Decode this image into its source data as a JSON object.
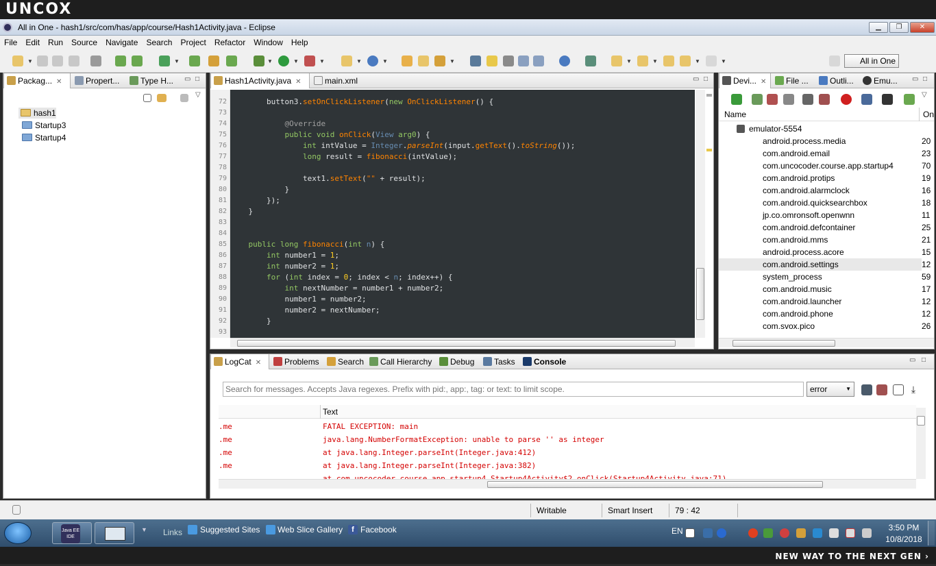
{
  "brand": {
    "top": "UNCOX",
    "bottom": "NEW WAY TO THE NEXT GEN ›"
  },
  "window": {
    "title": "All in One - hash1/src/com/has/app/course/Hash1Activity.java - Eclipse"
  },
  "menu": [
    "File",
    "Edit",
    "Run",
    "Source",
    "Navigate",
    "Search",
    "Project",
    "Refactor",
    "Window",
    "Help"
  ],
  "perspective": "All in One",
  "left_panel": {
    "tabs": [
      "Packag...",
      "Propert...",
      "Type H..."
    ],
    "tree": [
      "hash1",
      "Startup3",
      "Startup4"
    ]
  },
  "editor": {
    "tabs": [
      "Hash1Activity.java",
      "main.xml"
    ],
    "line_numbers": [
      "72",
      "73",
      "74",
      "75",
      "76",
      "77",
      "78",
      "79",
      "80",
      "81",
      "82",
      "83",
      "84",
      "85",
      "86",
      "87",
      "88",
      "89",
      "90",
      "91",
      "92",
      "93"
    ]
  },
  "devices_panel": {
    "tabs": [
      "Devi...",
      "File ...",
      "Outli...",
      "Emu..."
    ],
    "col_name": "Name",
    "col_other": "On",
    "emulator": "emulator-5554",
    "processes": [
      {
        "name": "android.process.media",
        "val": "20"
      },
      {
        "name": "com.android.email",
        "val": "23"
      },
      {
        "name": "com.uncocoder.course.app.startup4",
        "val": "70"
      },
      {
        "name": "com.android.protips",
        "val": "19"
      },
      {
        "name": "com.android.alarmclock",
        "val": "16"
      },
      {
        "name": "com.android.quicksearchbox",
        "val": "18"
      },
      {
        "name": "jp.co.omronsoft.openwnn",
        "val": "11"
      },
      {
        "name": "com.android.defcontainer",
        "val": "25"
      },
      {
        "name": "com.android.mms",
        "val": "21"
      },
      {
        "name": "android.process.acore",
        "val": "15"
      },
      {
        "name": "com.android.settings",
        "val": "12"
      },
      {
        "name": "system_process",
        "val": "59"
      },
      {
        "name": "com.android.music",
        "val": "17"
      },
      {
        "name": "com.android.launcher",
        "val": "12"
      },
      {
        "name": "com.android.phone",
        "val": "12"
      },
      {
        "name": "com.svox.pico",
        "val": "26"
      }
    ]
  },
  "console": {
    "tabs": [
      "LogCat",
      "Problems",
      "Search",
      "Call Hierarchy",
      "Debug",
      "Tasks",
      "Console"
    ],
    "search_placeholder": "Search for messages. Accepts Java regexes. Prefix with pid:, app:, tag: or text: to limit scope.",
    "level": "error",
    "col_text": "Text",
    "rows": [
      {
        "app": ".me",
        "text": "FATAL EXCEPTION: main"
      },
      {
        "app": ".me",
        "text": "java.lang.NumberFormatException: unable to parse '' as integer"
      },
      {
        "app": ".me",
        "text": "at java.lang.Integer.parseInt(Integer.java:412)"
      },
      {
        "app": ".me",
        "text": "at java.lang.Integer.parseInt(Integer.java:382)"
      }
    ]
  },
  "status": {
    "writable": "Writable",
    "insert": "Smart Insert",
    "position": "79 : 42"
  },
  "taskbar": {
    "links_label": "Links",
    "links": [
      "Suggested Sites",
      "Web Slice Gallery",
      "Facebook"
    ],
    "lang": "EN",
    "time": "3:50 PM",
    "date": "10/8/2018",
    "app_label": "Java EE IDE"
  },
  "colors": {
    "code_bg": "#2f3437",
    "keyword": "#93c763",
    "method": "#ff8400",
    "type": "#678cb1",
    "number": "#ffcd22",
    "error": "#d40000"
  }
}
